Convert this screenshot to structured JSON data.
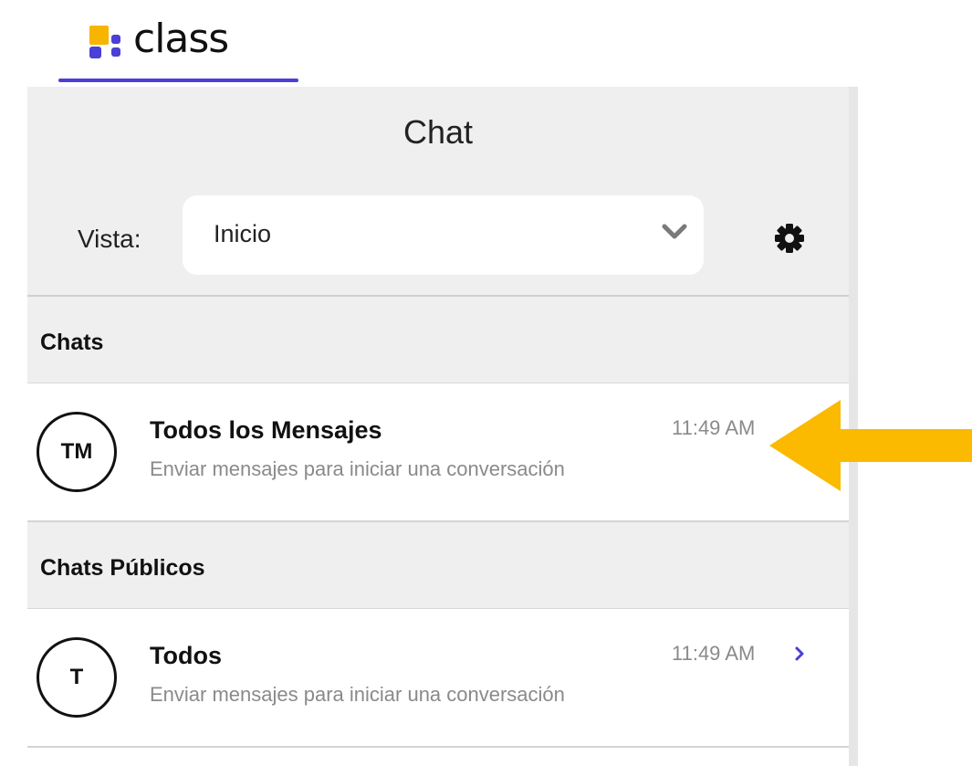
{
  "app": {
    "logo_text": "class",
    "brand_color": "#4a3fd6"
  },
  "panel": {
    "title": "Chat",
    "view_label": "Vista:",
    "view_selected": "Inicio"
  },
  "icons": {
    "logo": "class-logo-icon",
    "dropdown": "chevron-down-icon",
    "settings": "gear-icon",
    "row_open": "chevron-right-icon",
    "annotation": "arrow-left-icon"
  },
  "sections": {
    "chats": {
      "label": "Chats",
      "items": [
        {
          "initials": "TM",
          "name": "Todos los Mensajes",
          "preview": "Enviar mensajes para iniciar una conversación",
          "time": "11:49 AM"
        }
      ]
    },
    "public": {
      "label": "Chats Públicos",
      "items": [
        {
          "initials": "T",
          "name": "Todos",
          "preview": "Enviar mensajes para iniciar una conversación",
          "time": "11:49 AM"
        }
      ]
    }
  },
  "colors": {
    "annotation_arrow": "#fbb900",
    "chevron_accent": "#4a3fd6"
  }
}
